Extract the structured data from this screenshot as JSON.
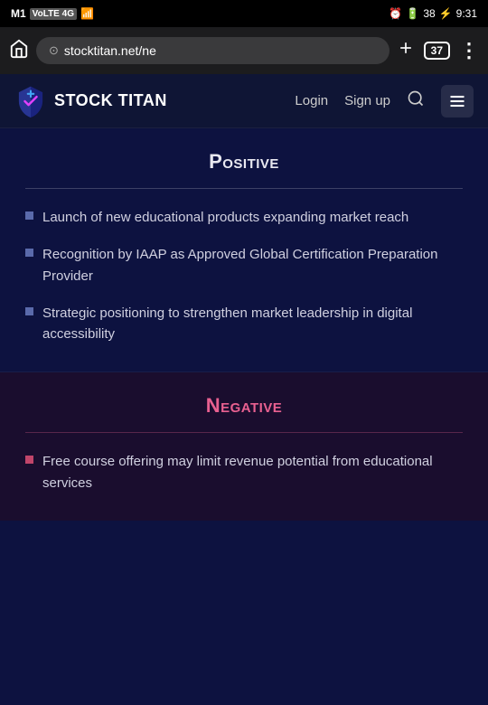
{
  "statusBar": {
    "carrier": "M1",
    "network": "VoLTE 4G",
    "time": "9:31",
    "battery": "38",
    "alarmIcon": "⏰"
  },
  "browserChrome": {
    "url": "stocktitan.net/ne",
    "tabCount": "37",
    "homeIcon": "⌂",
    "addTabIcon": "+",
    "moreIcon": "⋮"
  },
  "navbar": {
    "logoText": "STOCK TITAN",
    "loginLabel": "Login",
    "signupLabel": "Sign up",
    "menuIcon": "≡"
  },
  "positive": {
    "title": "Positive",
    "bullets": [
      "Launch of new educational products expanding market reach",
      "Recognition by IAAP as Approved Global Certification Preparation Provider",
      "Strategic positioning to strengthen market leadership in digital accessibility"
    ]
  },
  "negative": {
    "title": "Negative",
    "bullets": [
      "Free course offering may limit revenue potential from educational services"
    ]
  }
}
